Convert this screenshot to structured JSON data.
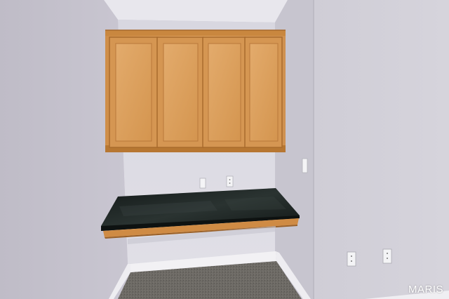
{
  "photo": {
    "watermark": "MARIS",
    "colors": {
      "wall_left": "#c3c0cb",
      "wall_back": "#dcdbe4",
      "wall_right": "#d3d1da",
      "ceiling": "#e7e6ec",
      "cabinet_wood": "#d99c55",
      "cabinet_panel": "#dea463",
      "granite": "#1d2422",
      "carpet": "#6d6a65",
      "baseboard": "#f1f0f3"
    }
  }
}
